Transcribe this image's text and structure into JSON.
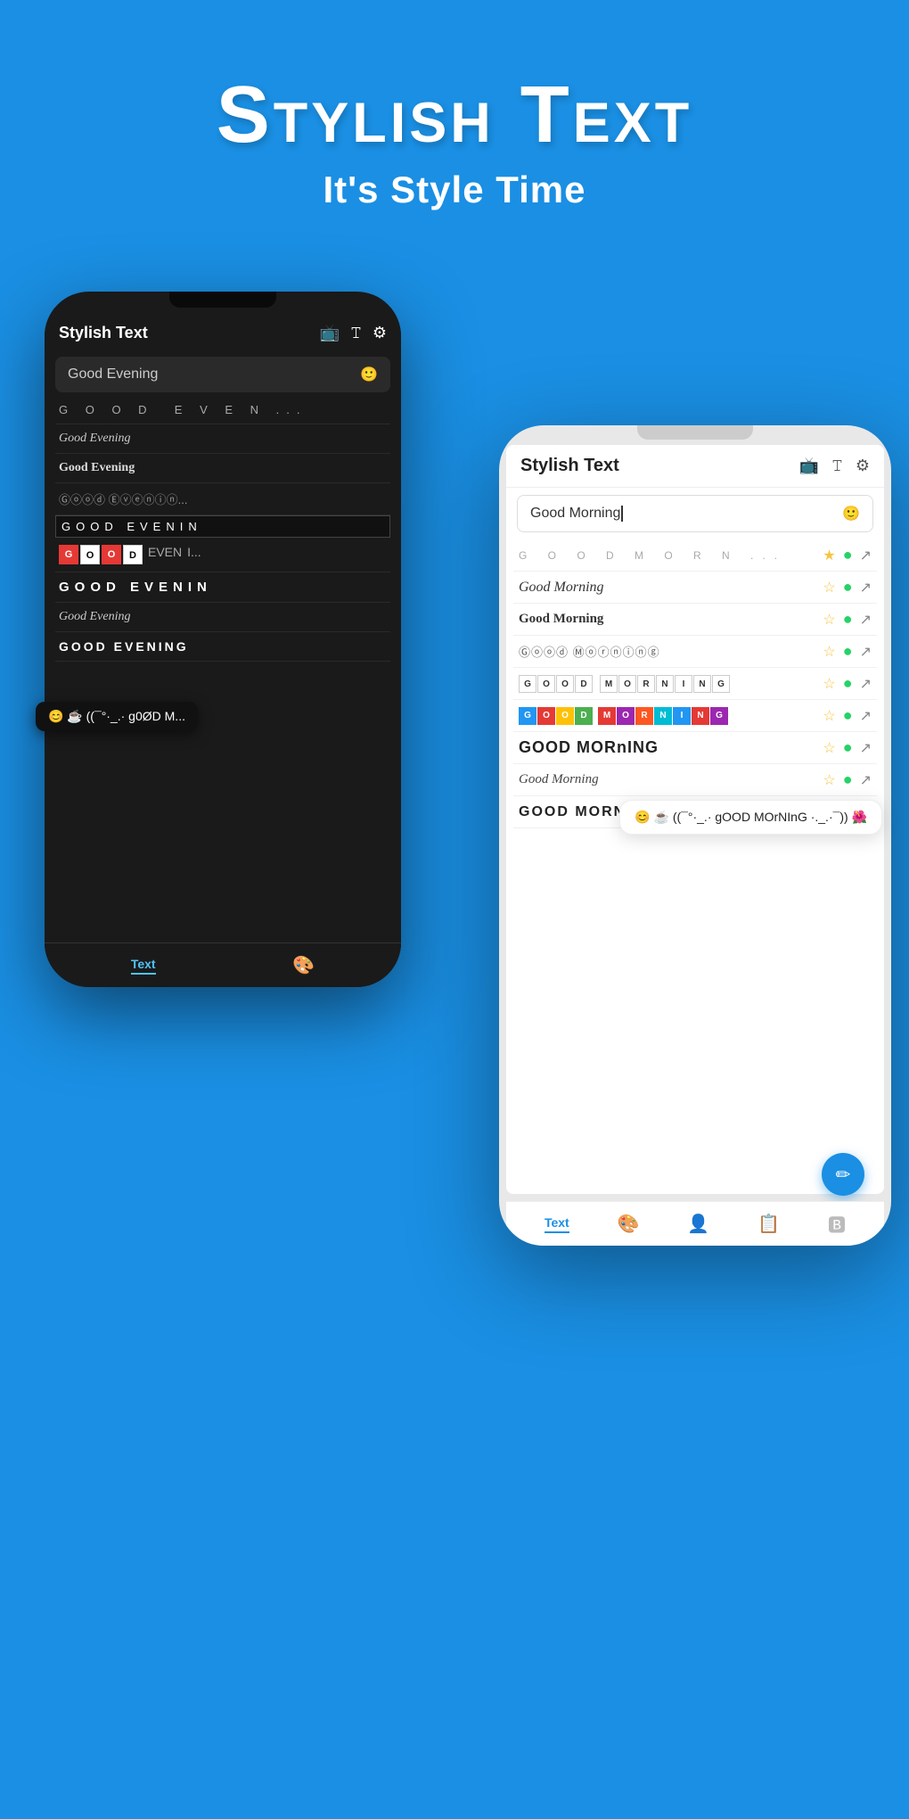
{
  "header": {
    "main_title": "Stylish Text",
    "sub_title": "It's Style Time"
  },
  "phone_back": {
    "app_title": "Stylish Text",
    "input_value": "Good Evening",
    "emoji_popup": "😊 ☕ ((¯°·_.· g0ØD M...",
    "text_styles": [
      {
        "label": "G O O D  E V E N...",
        "style": "spaced"
      },
      {
        "label": "Good Evening",
        "style": "italic"
      },
      {
        "label": "Good Evening",
        "style": "bold-serif"
      },
      {
        "label": "Ⓖⓞⓞⓓ Ⓔⓥⓔⓝⓘⓝ...",
        "style": "circle"
      },
      {
        "label": "GOOD EVENING",
        "style": "bar"
      },
      {
        "label": "GOOD EVENI...",
        "style": "box-colored"
      },
      {
        "label": "GOOD EVENIN",
        "style": "large-spaced"
      },
      {
        "label": "Good Evening",
        "style": "italic-fancy"
      },
      {
        "label": "GOOD EVENING",
        "style": "all-caps"
      }
    ],
    "bottom_tabs": [
      "Text",
      "🎨"
    ]
  },
  "phone_front": {
    "app_title": "Stylish Text",
    "input_value": "Good Morning",
    "input_cursor": true,
    "emoji_popup": "😊 ☕ ((¯°·_.· gOOD MOrNInG ·._.·¯)) 🌺",
    "text_styles": [
      {
        "label": "G O O D  M O R N...",
        "style": "spaced",
        "has_actions": true
      },
      {
        "label": "Good Morning",
        "style": "italic",
        "has_actions": true
      },
      {
        "label": "Good Morning",
        "style": "bold-serif",
        "has_actions": true
      },
      {
        "label": "Ⓖⓞⓞⓓ Ⓜⓞⓡⓝⓘⓝⓖ",
        "style": "circle",
        "has_actions": true
      },
      {
        "label": "G O O D  M O R N I N G",
        "style": "boxed",
        "has_actions": true
      },
      {
        "label": "GOOD MORNING",
        "style": "boxed-colored",
        "has_actions": true
      },
      {
        "label": "GOOD MORnING",
        "style": "large",
        "has_actions": true
      },
      {
        "label": "Good Morning",
        "style": "fancy",
        "has_actions": true
      },
      {
        "label": "GOOD MORNING",
        "style": "all-caps",
        "has_actions": true
      }
    ],
    "bottom_tabs": [
      "Text",
      "🎨",
      "👤",
      "📋",
      "🅱"
    ]
  },
  "icons": {
    "tv": "📺",
    "font": "🖊",
    "settings": "⚙",
    "emoji": "🙂",
    "search": "🔍",
    "star": "⭐",
    "whatsapp": "💬",
    "share": "↗"
  },
  "colors": {
    "background": "#1a8fe3",
    "dark_phone_bg": "#1a1a1a",
    "light_phone_bg": "#f0f0f0",
    "accent": "#1a8fe3",
    "tab_active": "#4fc3f7"
  }
}
